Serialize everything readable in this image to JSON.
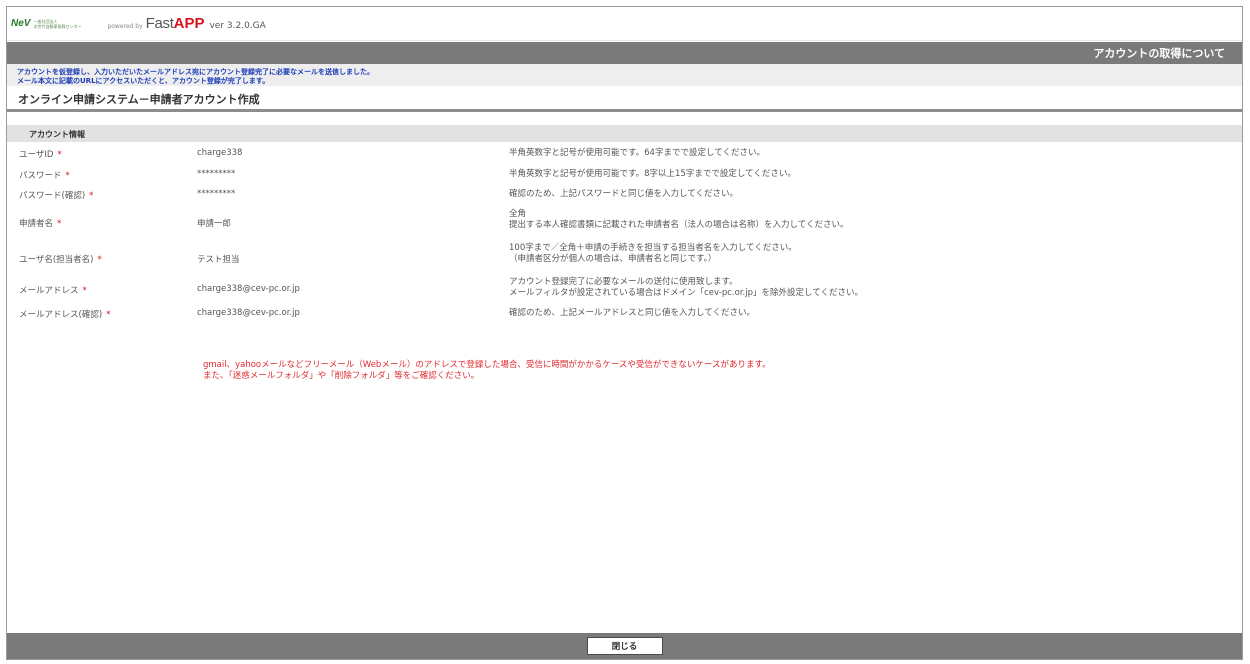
{
  "header": {
    "logo_mark": "NeV",
    "logo_line1": "一般社団法人",
    "logo_line2": "次世代自動車振興センター",
    "powered_by": "powered by",
    "brand_fast": "Fast",
    "brand_app": "APP",
    "version": "ver 3.2.0.GA"
  },
  "band": {
    "title": "アカウントの取得について"
  },
  "notice": {
    "line1": "アカウントを仮登録し、入力いただいたメールアドレス宛にアカウント登録完了に必要なメールを送信しました。",
    "line2": "メール本文に記載のURLにアクセスいただくと、アカウント登録が完了します。"
  },
  "page_title": "オンライン申請システム－申請者アカウント作成",
  "section": {
    "title": "アカウント情報"
  },
  "fields": [
    {
      "label": "ユーザID",
      "required": "*",
      "value": "charge338",
      "help1": "半角英数字と記号が使用可能です。64字までで設定してください。",
      "help2": ""
    },
    {
      "label": "パスワード",
      "required": "*",
      "value": "*********",
      "help1": "半角英数字と記号が使用可能です。8字以上15字までで設定してください。",
      "help2": ""
    },
    {
      "label": "パスワード(確認)",
      "required": "*",
      "value": "*********",
      "help1": "確認のため、上記パスワードと同じ値を入力してください。",
      "help2": ""
    },
    {
      "label": "申請者名",
      "required": "*",
      "value": "申請一郎",
      "help1": "全角",
      "help2": "提出する本人確認書類に記載された申請者名（法人の場合は名称）を入力してください。"
    },
    {
      "label": "ユーザ名(担当者名)",
      "required": "*",
      "value": "テスト担当",
      "help1": "100字まで／全角＋申請の手続きを担当する担当者名を入力してください。",
      "help2": "（申請者区分が個人の場合は、申請者名と同じです。）"
    },
    {
      "label": "メールアドレス",
      "required": "*",
      "value": "charge338@cev-pc.or.jp",
      "help1": "アカウント登録完了に必要なメールの送付に使用致します。",
      "help2": "メールフィルタが設定されている場合はドメイン「cev-pc.or.jp」を除外設定してください。"
    },
    {
      "label": "メールアドレス(確認)",
      "required": "*",
      "value": "charge338@cev-pc.or.jp",
      "help1": "確認のため、上記メールアドレスと同じ値を入力してください。",
      "help2": ""
    }
  ],
  "warning": {
    "line1": "gmail、yahooメールなどフリーメール（Webメール）のアドレスで登録した場合、受信に時間がかかるケースや受信ができないケースがあります。",
    "line2": "また、「迷惑メールフォルダ」や「削除フォルダ」等をご確認ください。"
  },
  "footer": {
    "close_label": "閉じる"
  }
}
